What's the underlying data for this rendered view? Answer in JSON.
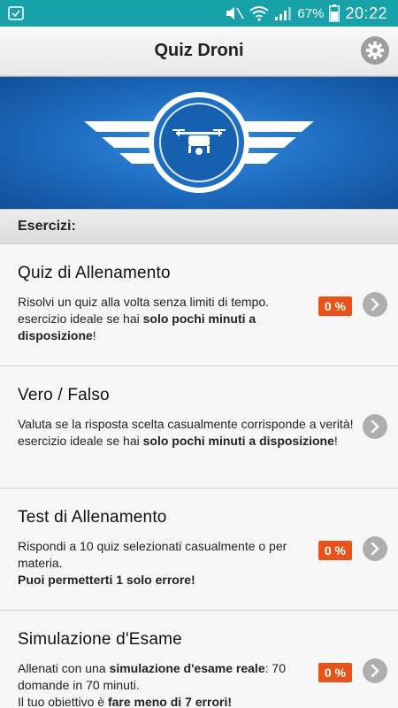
{
  "status": {
    "battery": "67%",
    "time": "20:22"
  },
  "appbar": {
    "title": "Quiz Droni"
  },
  "section_title": "Esercizi:",
  "items": [
    {
      "title": "Quiz di Allenamento",
      "desc_a": "Risolvi un quiz alla volta senza limiti di tempo. esercizio ideale se hai ",
      "desc_b": "solo pochi minuti a disposizione",
      "desc_c": "!",
      "badge": "0 %"
    },
    {
      "title": "Vero / Falso",
      "desc_a": "Valuta se la risposta scelta casualmente corrisponde a verità!",
      "desc_b": "esercizio ideale se hai ",
      "desc_c": "solo pochi minuti a disposizione",
      "desc_d": "!"
    },
    {
      "title": "Test di Allenamento",
      "desc_a": "Rispondi a 10 quiz selezionati casualmente o per materia.",
      "desc_b": "Puoi permetterti 1 solo errore!",
      "badge": "0 %"
    },
    {
      "title": "Simulazione d'Esame",
      "desc_a": "Allenati con una ",
      "desc_b": "simulazione d'esame reale",
      "desc_c": ": 70 domande in 70 minuti.",
      "desc_d": "Il tuo obiettivo è ",
      "desc_e": "fare meno di 7 errori!",
      "badge": "0 %"
    }
  ]
}
